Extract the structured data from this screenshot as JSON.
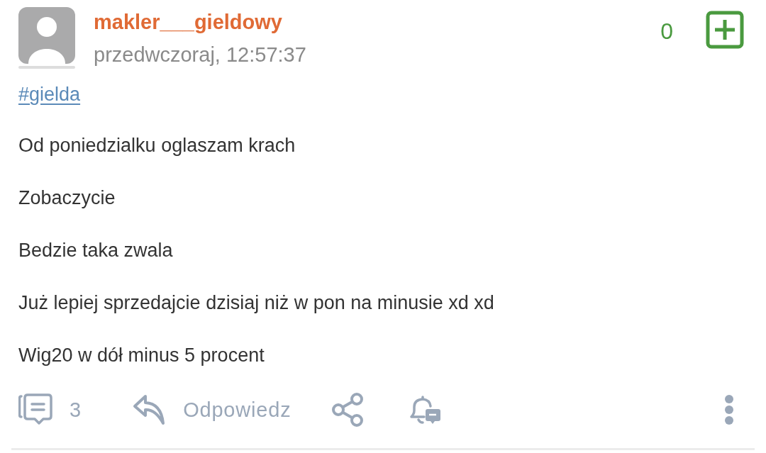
{
  "post": {
    "author": {
      "username": "makler___gieldowy",
      "timestamp": "przedwczoraj, 12:57:37"
    },
    "score": "0",
    "tags": [
      "#gielda"
    ],
    "paragraphs": [
      "Od poniedzialku oglaszam krach",
      "Zobaczycie",
      "Bedzie taka zwala",
      "Już lepiej sprzedajcie dzisiaj niż w pon na minusie xd xd",
      "Wig20 w dół minus 5 procent"
    ],
    "actions": {
      "comments_count": "3",
      "reply_label": "Odpowiedz"
    }
  }
}
